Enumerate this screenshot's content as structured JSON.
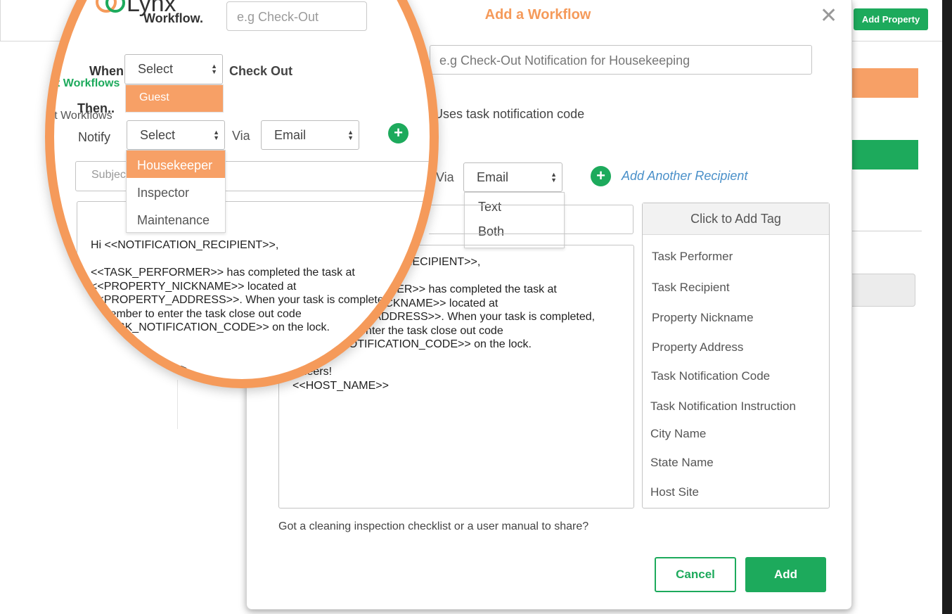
{
  "background": {
    "logo_text": "Lynx",
    "header_subtitle": "Workflow.",
    "search_placeholder": "e.g Check-Out",
    "add_property_label": "Add Property",
    "sidebar_title": "Smart Workflows",
    "sidebar_item": "Smart Workflows"
  },
  "colors": {
    "accent_orange": "#f59a5a",
    "brand_green": "#1daa5c",
    "link_blue": "#4a90c9"
  },
  "modal": {
    "title": "Add a Workflow",
    "close_icon": "close-icon",
    "name_placeholder": "e.g Check-Out Notification for Housekeeping",
    "when_label": "When",
    "when_select": "Select",
    "when_options": [
      "Guest"
    ],
    "event_label": "Check Out",
    "then_label": "Then..",
    "code_text": "Uses task notification code",
    "notify_label": "Notify",
    "notify_select": "Select",
    "notify_options": [
      "Housekeeper",
      "Inspector",
      "Maintenance"
    ],
    "via_label": "Via",
    "via_select": "Email",
    "via_options": [
      "Text",
      "Both"
    ],
    "add_recipient": "Add Another Recipient",
    "subject_placeholder": "Subject",
    "message_body": "Hi <<NOTIFICATION_RECIPIENT>>,\n\n<<TASK_PERFORMER>> has completed the task at\n<<PROPERTY_NICKNAME>> located at\n<<PROPERTY_ADDRESS>>. When your task is completed,\nremember to enter the task close out code\n<<TASK_NOTIFICATION_CODE>> on the lock.\n\nCheers!\n<<HOST_NAME>>",
    "tag_panel_title": "Click to Add Tag",
    "tags": [
      "Task Performer",
      "Task Recipient",
      "Property Nickname",
      "Property Address",
      "Task Notification Code",
      "Task Notification Instruction",
      "City Name",
      "State Name",
      "Host Site"
    ],
    "share_text": "Got a cleaning inspection checklist or a user manual to share?",
    "cancel_label": "Cancel",
    "add_label": "Add"
  }
}
